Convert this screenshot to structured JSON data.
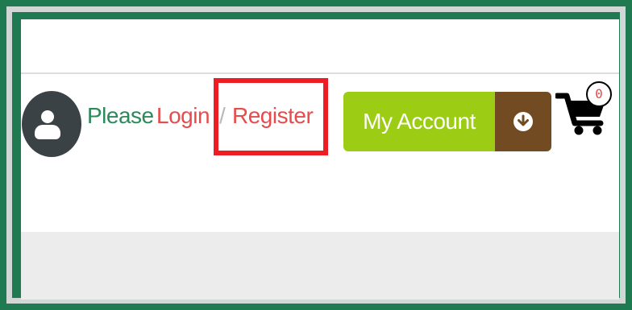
{
  "auth": {
    "prompt": "Please",
    "login": "Login",
    "separator": "/",
    "register": "Register"
  },
  "account_button": {
    "label": "My Account",
    "dropdown_icon": "arrow-down-circle-icon"
  },
  "cart": {
    "count": "0",
    "icon": "shopping-cart-icon"
  },
  "colors": {
    "frame": "#1f7a52",
    "link": "#e84b4b",
    "prompt": "#2c8a5a",
    "highlight": "#ee1d23",
    "account": "#9ccc13",
    "account_dropdown": "#724b22"
  }
}
